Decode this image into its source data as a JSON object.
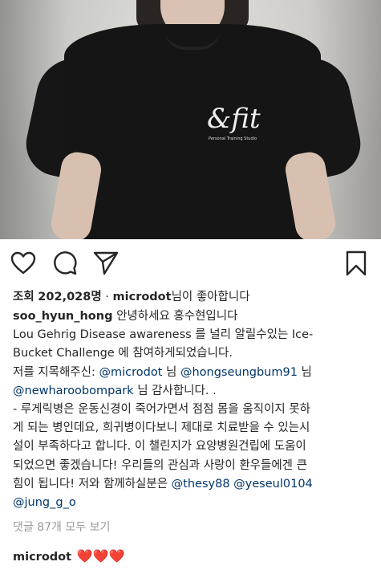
{
  "media": {
    "logo_mark": "&fit",
    "logo_subtext": "Personal Training Studio"
  },
  "actions": {
    "like_icon": "heart-icon",
    "comment_icon": "comment-icon",
    "share_icon": "send-icon",
    "save_icon": "bookmark-icon"
  },
  "views": {
    "label": "조회",
    "count": "202,028명",
    "liked_by_user": "microdot",
    "liked_by_suffix": "님이 좋아합니다"
  },
  "caption": {
    "username": "soo_hyun_hong",
    "line1": "안녕하세요 홍수현입니다",
    "line2": "Lou Gehrig Disease awareness 를 널리 알릴수있는 Ice-",
    "line3": "Bucket Challenge 에 참여하게되었습니다.",
    "line4_prefix": "저를 지목해주신: ",
    "mention1": "@microdot",
    "line4_mid": " 님 ",
    "mention2": "@hongseungbum91",
    "line4_suffix": " 님",
    "mention3": "@newharoobompark",
    "line5_suffix": " 님 감사합니다. .",
    "line6": "- 루게릭병은 운동신경이 죽어가면서 점점 몸을 움직이지 못하",
    "line7": "게 되는 병인데요, 희귀병이다보니 제대로 치료받을 수 있는시",
    "line8": "설이 부족하다고 합니다. 이 챌린지가 요양병원건립에 도움이",
    "line9": "되었으면 좋겠습니다! 우리들의 관심과 사랑이 환우들에겐 큰",
    "line10_prefix": "힘이 됩니다! 저와 함께하실분은 ",
    "mention4": "@thesy88",
    "mention5": "@yeseul0104",
    "mention6": "@jung_g_o"
  },
  "comments": {
    "view_all": "댓글 87개 모두 보기"
  },
  "comment": {
    "username": "microdot",
    "text": "❤️❤️❤️"
  }
}
